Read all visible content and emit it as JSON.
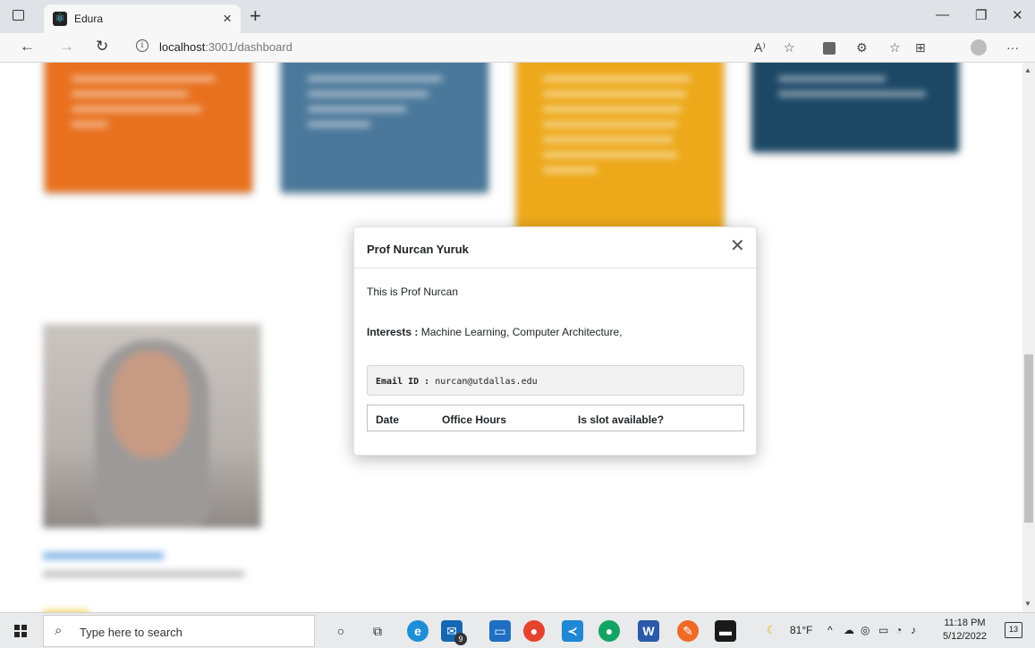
{
  "browser": {
    "tab_title": "Edura",
    "url_host": "localhost",
    "url_rest": ":3001/dashboard",
    "new_tab": "+"
  },
  "icons": {
    "tab_actions": "square-icon",
    "favicon": "react-icon",
    "back": "back-arrow-icon",
    "forward": "forward-arrow-icon",
    "refresh": "refresh-icon",
    "info": "info-icon",
    "read_aloud": "read-aloud-icon",
    "favorite": "star-add-icon",
    "extension": "extension-icon",
    "settings_more": "ellipsis-icon"
  },
  "colors": {
    "card_orange": "#e8711f",
    "card_slate": "#4b789a",
    "card_yellow": "#eda91a",
    "card_navy": "#1c4866"
  },
  "modal": {
    "title": "Prof Nurcan Yuruk",
    "description": "This is Prof Nurcan",
    "interests_label": "Interests :",
    "interests_value": "Machine Learning, Computer Architecture,",
    "email_label": "Email ID :",
    "email_value": "nurcan@utdallas.edu",
    "table_headers": [
      "Date",
      "Office Hours",
      "Is slot available?"
    ]
  },
  "taskbar": {
    "search_placeholder": "Type here to search",
    "mail_badge": "9",
    "weather": "81°F",
    "time": "11:18 PM",
    "date": "5/12/2022",
    "notifications": "13"
  }
}
